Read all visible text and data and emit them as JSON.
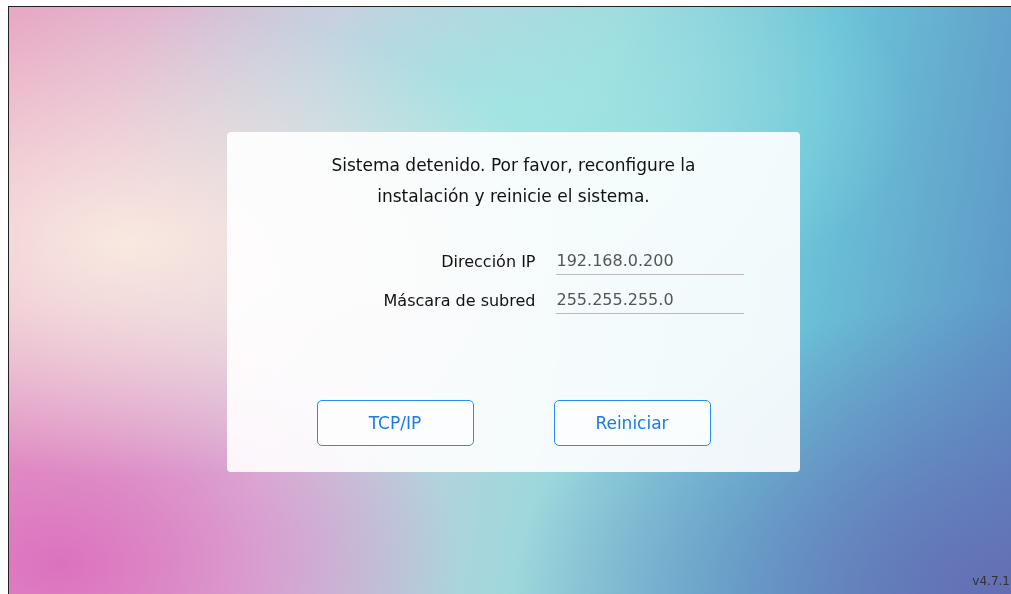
{
  "dialog": {
    "message": "Sistema detenido. Por favor, reconfigure la instalación y reinicie el sistema.",
    "fields": [
      {
        "label": "Dirección IP",
        "value": "192.168.0.200"
      },
      {
        "label": "Máscara de subred",
        "value": "255.255.255.0"
      }
    ],
    "buttons": [
      "TCP/IP",
      "Reiniciar"
    ]
  },
  "version": "v4.7.1"
}
